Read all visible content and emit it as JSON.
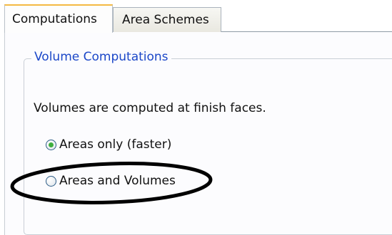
{
  "tabs": [
    {
      "label": "Computations"
    },
    {
      "label": "Area Schemes"
    }
  ],
  "volume_group": {
    "title": "Volume Computations",
    "info": "Volumes are computed at finish faces.",
    "options": [
      {
        "label": "Areas only (faster)",
        "selected": true
      },
      {
        "label": "Areas and Volumes",
        "selected": false
      }
    ]
  },
  "colors": {
    "legend_text": "#1b47c8",
    "radio_selected": "#3fae3f",
    "active_tab_accent": "#f4b942",
    "annotation_ellipse": "#000000"
  }
}
